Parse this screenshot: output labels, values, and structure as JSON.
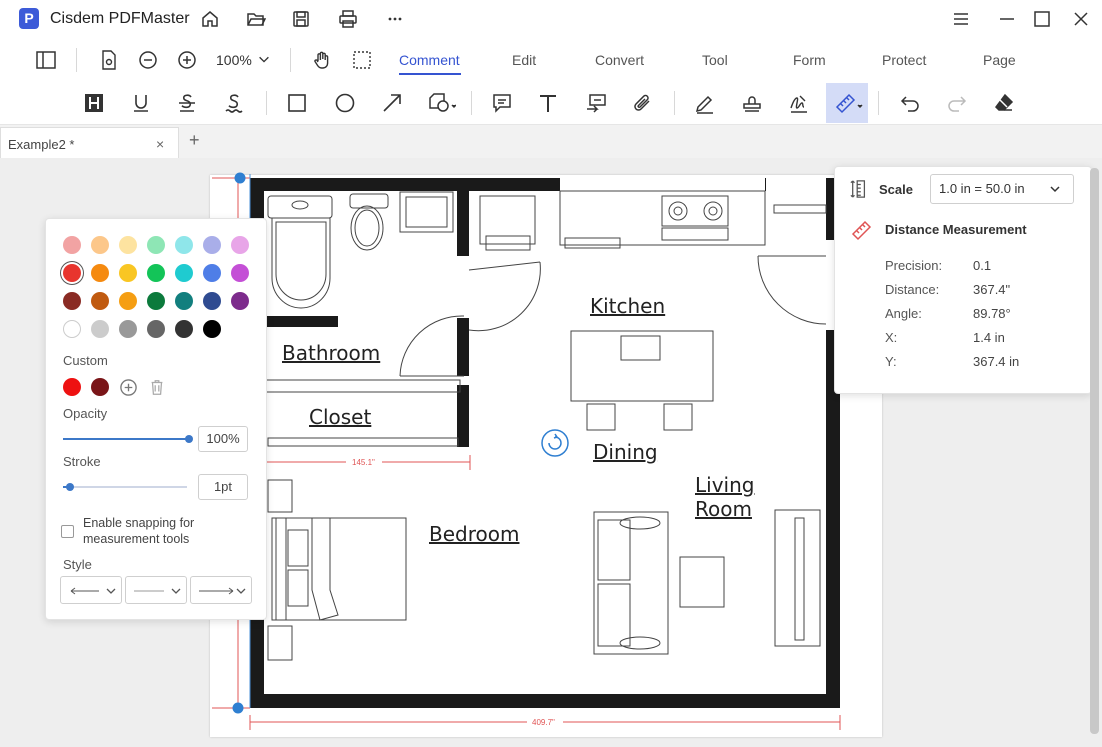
{
  "app": {
    "title": "Cisdem PDFMaster",
    "logo_letter": "P"
  },
  "titlebar_icons": [
    "home-icon",
    "open-folder-icon",
    "save-icon",
    "print-icon",
    "more-icon",
    "menu-icon",
    "maximize-icon",
    "close-icon"
  ],
  "toolbar": {
    "zoom": "100%",
    "tabs": [
      "Comment",
      "Edit",
      "Convert",
      "Tool",
      "Form",
      "Protect",
      "Page"
    ],
    "active_tab": "Comment"
  },
  "document_tab": {
    "label": "Example2 *",
    "close": "×",
    "add": "+"
  },
  "plan": {
    "rooms": [
      "Kitchen",
      "Bathroom",
      "Closet",
      "Dining",
      "Living",
      "Room",
      "Bedroom"
    ],
    "measure_horizontal": "145.1\"",
    "measure_bottom": "409.7\""
  },
  "color_panel": {
    "preset_colors": [
      [
        "#f2a3a3",
        "#fcc78a",
        "#fde3a0",
        "#8ee6b5",
        "#8fe6ea",
        "#a9aee9",
        "#e8a5e8"
      ],
      [
        "#e8352e",
        "#f58a10",
        "#f9c623",
        "#13c458",
        "#1fcbd0",
        "#4f7ee7",
        "#c44fd6"
      ],
      [
        "#8a2b24",
        "#c05a10",
        "#f59e12",
        "#0c7a3c",
        "#127f7e",
        "#2f4b91",
        "#7d2b8c"
      ],
      [
        "#ffffff",
        "#cccccc",
        "#999999",
        "#666666",
        "#333333",
        "#000000"
      ]
    ],
    "custom_label": "Custom",
    "custom_colors": [
      "#ee1111",
      "#7a1518"
    ],
    "opacity_label": "Opacity",
    "opacity_value": "100%",
    "opacity_level": 1.0,
    "stroke_label": "Stroke",
    "stroke_value": "1pt",
    "stroke_level": 0.06,
    "snapping_line1": "Enable snapping for",
    "snapping_line2": "measurement tools",
    "style_label": "Style"
  },
  "measure_panel": {
    "scale_label": "Scale",
    "scale_value": "1.0 in = 50.0 in",
    "title": "Distance Measurement",
    "props": [
      {
        "label": "Precision:",
        "value": "0.1"
      },
      {
        "label": "Distance:",
        "value": "367.4\""
      },
      {
        "label": "Angle:",
        "value": "89.78°"
      },
      {
        "label": "X:",
        "value": "1.4 in"
      },
      {
        "label": "Y:",
        "value": "367.4 in"
      }
    ]
  },
  "colors": {
    "accent": "#3554d1",
    "measure_red": "#e05555",
    "handle_blue": "#2f7fd1"
  }
}
